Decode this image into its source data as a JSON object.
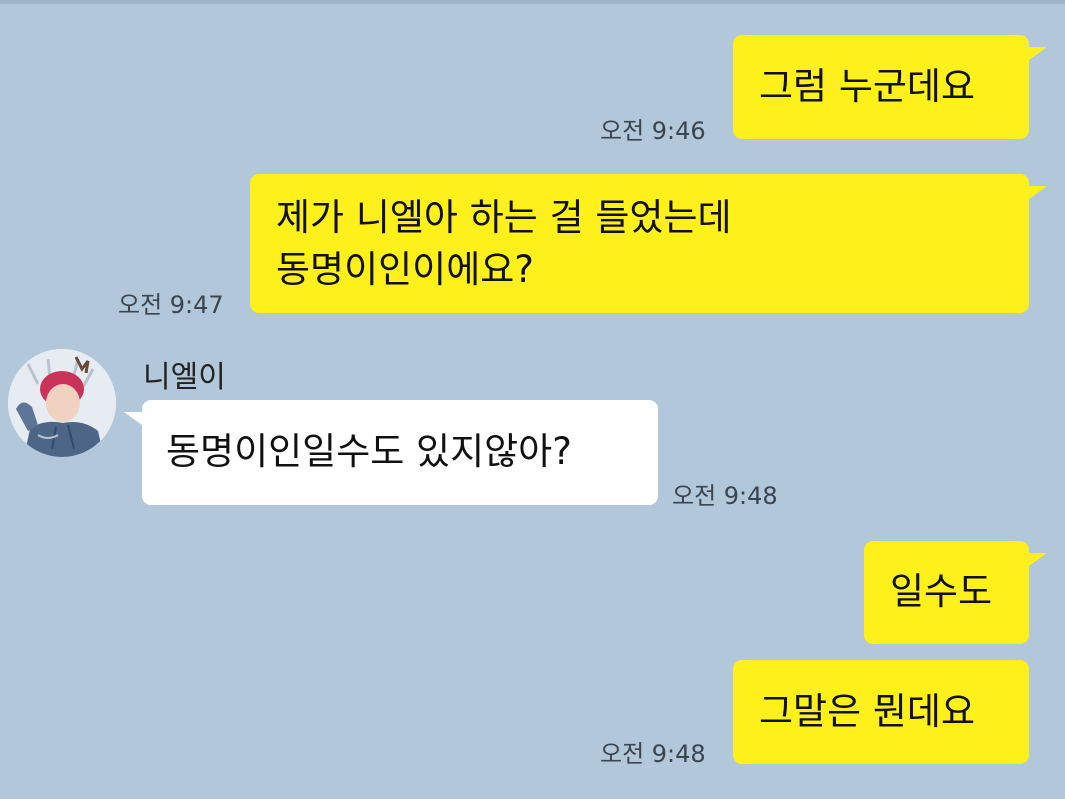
{
  "chat": {
    "messages": [
      {
        "side": "me",
        "lines": [
          "그럼 누군데요"
        ],
        "time": "오전 9:46"
      },
      {
        "side": "me",
        "lines": [
          "제가 니엘아 하는 걸 들었는데",
          "동명이인이에요?"
        ],
        "time": "오전 9:47"
      },
      {
        "side": "other",
        "sender": "니엘이",
        "lines": [
          "동명이인일수도 있지않아?"
        ],
        "time": "오전 9:48"
      },
      {
        "side": "me",
        "lines": [
          "일수도"
        ],
        "time": ""
      },
      {
        "side": "me",
        "lines": [
          "그말은 뭔데요"
        ],
        "time": "오전 9:48"
      }
    ]
  },
  "colors": {
    "background": "#b2c7da",
    "my_bubble": "#fef01b",
    "other_bubble": "#ffffff",
    "timestamp": "#3b4550"
  },
  "icons": {
    "avatar": "profile-photo"
  }
}
